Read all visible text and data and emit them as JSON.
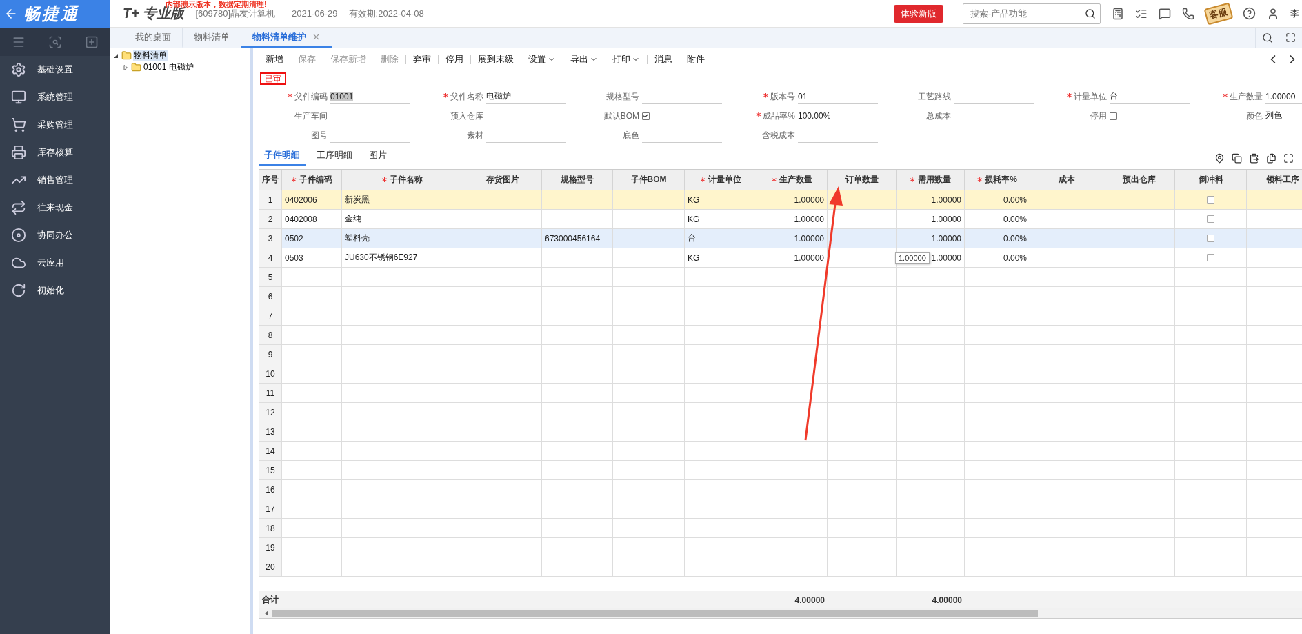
{
  "header": {
    "logo": "畅捷通",
    "product": "T+ 专业版",
    "notice": "内部演示版本，数据定期清理!",
    "company": "[609780]晶友计算机",
    "date": "2021-06-29",
    "validity": "有效期:2022-04-08",
    "trial_button": "体验新版",
    "search": {
      "placeholder": "搜索-产品功能"
    },
    "service_badge": "客服",
    "user": "李"
  },
  "sidebar": {
    "items": [
      {
        "label": "基础设置"
      },
      {
        "label": "系统管理"
      },
      {
        "label": "采购管理"
      },
      {
        "label": "库存核算"
      },
      {
        "label": "销售管理"
      },
      {
        "label": "往来现金"
      },
      {
        "label": "协同办公"
      },
      {
        "label": "云应用"
      },
      {
        "label": "初始化"
      }
    ]
  },
  "tabs": [
    {
      "label": "我的桌面",
      "selected": false,
      "closable": false
    },
    {
      "label": "物料清单",
      "selected": false,
      "closable": false
    },
    {
      "label": "物料清单维护",
      "selected": true,
      "closable": true
    }
  ],
  "tree": [
    {
      "label": "物料清单",
      "expanded": true,
      "selected": true,
      "children": [
        {
          "label": "01001 电磁炉",
          "expanded": false,
          "selected": false
        }
      ]
    }
  ],
  "toolbar": [
    {
      "label": "新增",
      "disabled": false,
      "dropdown": false,
      "separator": false
    },
    {
      "label": "保存",
      "disabled": true,
      "dropdown": false,
      "separator": false
    },
    {
      "label": "保存新增",
      "disabled": true,
      "dropdown": false,
      "separator": false
    },
    {
      "label": "删除",
      "disabled": true,
      "dropdown": false,
      "separator": true
    },
    {
      "label": "弃审",
      "disabled": false,
      "dropdown": false,
      "separator": true
    },
    {
      "label": "停用",
      "disabled": false,
      "dropdown": false,
      "separator": true
    },
    {
      "label": "展到末级",
      "disabled": false,
      "dropdown": false,
      "separator": true
    },
    {
      "label": "设置",
      "disabled": false,
      "dropdown": true,
      "separator": true
    },
    {
      "label": "导出",
      "disabled": false,
      "dropdown": true,
      "separator": true
    },
    {
      "label": "打印",
      "disabled": false,
      "dropdown": true,
      "separator": true
    },
    {
      "label": "消息",
      "disabled": false,
      "dropdown": false,
      "separator": false
    },
    {
      "label": "附件",
      "disabled": false,
      "dropdown": false,
      "separator": false
    }
  ],
  "status": "已审",
  "form": [
    {
      "label": "父件编码",
      "required": true,
      "kind": "text",
      "value": "01001",
      "highlighted": true
    },
    {
      "label": "父件名称",
      "required": true,
      "kind": "text",
      "value": "电磁炉",
      "highlighted": false
    },
    {
      "label": "规格型号",
      "required": false,
      "kind": "text"
    },
    {
      "label": "版本号",
      "required": true,
      "kind": "text",
      "value": "01",
      "highlighted": false
    },
    {
      "label": "工艺路线",
      "required": false,
      "kind": "text"
    },
    {
      "label": "计量单位",
      "required": true,
      "kind": "text",
      "value": "台",
      "highlighted": false
    },
    {
      "label": "生产数量",
      "required": true,
      "kind": "text",
      "value": "1.00000",
      "highlighted": false
    },
    {
      "label": "生产车间",
      "required": false,
      "kind": "text"
    },
    {
      "label": "预入仓库",
      "required": false,
      "kind": "text"
    },
    {
      "label": "默认BOM",
      "required": false,
      "kind": "checkbox",
      "checked": true
    },
    {
      "label": "成品率%",
      "required": true,
      "kind": "text",
      "value": "100.00%",
      "highlighted": false
    },
    {
      "label": "总成本",
      "required": false,
      "kind": "text"
    },
    {
      "label": "停用",
      "required": false,
      "kind": "checkbox",
      "checked": false
    },
    {
      "label": "颜色",
      "required": false,
      "kind": "text",
      "value": "列色",
      "highlighted": false
    },
    {
      "label": "图号",
      "required": false,
      "kind": "text"
    },
    {
      "label": "素材",
      "required": false,
      "kind": "text"
    },
    {
      "label": "底色",
      "required": false,
      "kind": "text"
    },
    {
      "label": "含税成本",
      "required": false,
      "kind": "text"
    }
  ],
  "detail_tabs": [
    {
      "label": "子件明细",
      "selected": true
    },
    {
      "label": "工序明细",
      "selected": false
    },
    {
      "label": "图片",
      "selected": false
    }
  ],
  "table": {
    "columns": [
      {
        "label": "序号",
        "required": false,
        "kind": "index"
      },
      {
        "label": "子件编码",
        "required": true,
        "kind": "text"
      },
      {
        "label": "子件名称",
        "required": true,
        "kind": "text"
      },
      {
        "label": "存货图片",
        "required": false,
        "kind": "text"
      },
      {
        "label": "规格型号",
        "required": false,
        "kind": "text"
      },
      {
        "label": "子件BOM",
        "required": false,
        "kind": "text"
      },
      {
        "label": "计量单位",
        "required": true,
        "kind": "text"
      },
      {
        "label": "生产数量",
        "required": true,
        "kind": "number"
      },
      {
        "label": "订单数量",
        "required": false,
        "kind": "number"
      },
      {
        "label": "需用数量",
        "required": true,
        "kind": "number"
      },
      {
        "label": "损耗率%",
        "required": true,
        "kind": "number"
      },
      {
        "label": "成本",
        "required": false,
        "kind": "number"
      },
      {
        "label": "预出仓库",
        "required": false,
        "kind": "text"
      },
      {
        "label": "倒冲料",
        "required": false,
        "kind": "check"
      },
      {
        "label": "领料工序",
        "required": false,
        "kind": "text"
      }
    ],
    "rows": [
      {
        "no": "1",
        "selected": true,
        "focused": false,
        "code": "0402006",
        "name": "新炭黑",
        "unit": "KG",
        "qty": "1.00000",
        "need": "1.00000",
        "loss": "0.00%",
        "backflush": false
      },
      {
        "no": "2",
        "selected": false,
        "focused": false,
        "code": "0402008",
        "name": "金纯",
        "unit": "KG",
        "qty": "1.00000",
        "need": "1.00000",
        "loss": "0.00%",
        "backflush": false
      },
      {
        "no": "3",
        "selected": false,
        "focused": true,
        "code": "0502",
        "name": "塑料壳",
        "spec": "673000456164",
        "unit": "台",
        "qty": "1.00000",
        "need": "1.00000",
        "loss": "0.00%",
        "backflush": false
      },
      {
        "no": "4",
        "selected": false,
        "focused": false,
        "code": "0503",
        "name": "JU630不锈钢6E927",
        "unit": "KG",
        "qty": "1.00000",
        "need": "1.00000",
        "loss": "0.00%",
        "backflush": false
      },
      {
        "no": "5"
      },
      {
        "no": "6"
      },
      {
        "no": "7"
      },
      {
        "no": "8"
      },
      {
        "no": "9"
      },
      {
        "no": "10"
      },
      {
        "no": "11"
      },
      {
        "no": "12"
      },
      {
        "no": "13"
      },
      {
        "no": "14"
      },
      {
        "no": "15"
      },
      {
        "no": "16"
      },
      {
        "no": "17"
      },
      {
        "no": "18"
      },
      {
        "no": "19"
      },
      {
        "no": "20"
      }
    ],
    "tooltip": "1.00000",
    "totals": {
      "label": "合计",
      "qty": "4.00000",
      "need": "4.00000"
    }
  }
}
